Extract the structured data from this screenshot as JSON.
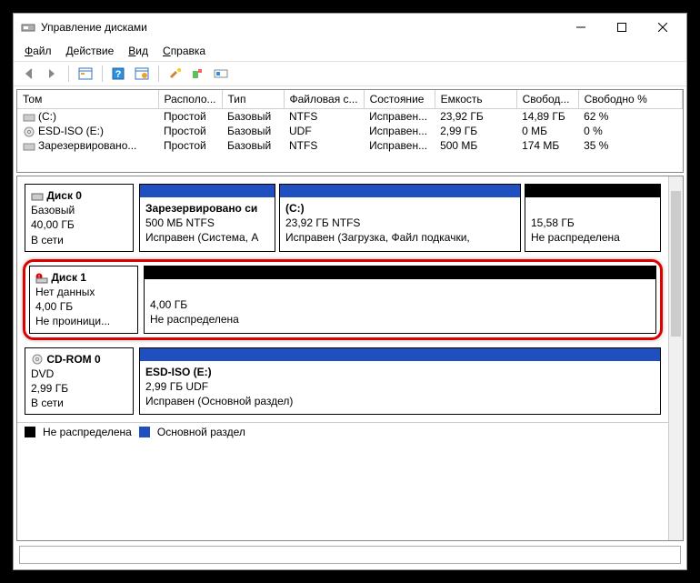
{
  "window": {
    "title": "Управление дисками"
  },
  "menu": {
    "file": "Файл",
    "action": "Действие",
    "view": "Вид",
    "help": "Справка"
  },
  "table": {
    "headers": {
      "volume": "Том",
      "layout": "Располо...",
      "type": "Тип",
      "fs": "Файловая с...",
      "status": "Состояние",
      "capacity": "Емкость",
      "free": "Свобод...",
      "freepct": "Свободно %"
    },
    "rows": [
      {
        "volume": "(C:)",
        "layout": "Простой",
        "type": "Базовый",
        "fs": "NTFS",
        "status": "Исправен...",
        "capacity": "23,92 ГБ",
        "free": "14,89 ГБ",
        "freepct": "62 %"
      },
      {
        "volume": "ESD-ISO (E:)",
        "layout": "Простой",
        "type": "Базовый",
        "fs": "UDF",
        "status": "Исправен...",
        "capacity": "2,99 ГБ",
        "free": "0 МБ",
        "freepct": "0 %"
      },
      {
        "volume": "Зарезервировано...",
        "layout": "Простой",
        "type": "Базовый",
        "fs": "NTFS",
        "status": "Исправен...",
        "capacity": "500 МБ",
        "free": "174 МБ",
        "freepct": "35 %"
      }
    ]
  },
  "disks": {
    "d0": {
      "name": "Диск 0",
      "type": "Базовый",
      "size": "40,00 ГБ",
      "state": "В сети",
      "p0": {
        "title": "Зарезервировано си",
        "line": "500 МБ NTFS",
        "status": "Исправен (Система, А"
      },
      "p1": {
        "title": "(C:)",
        "line": "23,92 ГБ NTFS",
        "status": "Исправен (Загрузка, Файл подкачки,"
      },
      "p2": {
        "line": "15,58 ГБ",
        "status": "Не распределена"
      }
    },
    "d1": {
      "name": "Диск 1",
      "type": "Нет данных",
      "size": "4,00 ГБ",
      "state": "Не проиници...",
      "p0": {
        "line": "4,00 ГБ",
        "status": "Не распределена"
      }
    },
    "d2": {
      "name": "CD-ROM 0",
      "type": "DVD",
      "size": "2,99 ГБ",
      "state": "В сети",
      "p0": {
        "title": "ESD-ISO  (E:)",
        "line": "2,99 ГБ UDF",
        "status": "Исправен (Основной раздел)"
      }
    }
  },
  "legend": {
    "unalloc": "Не распределена",
    "primary": "Основной раздел"
  }
}
